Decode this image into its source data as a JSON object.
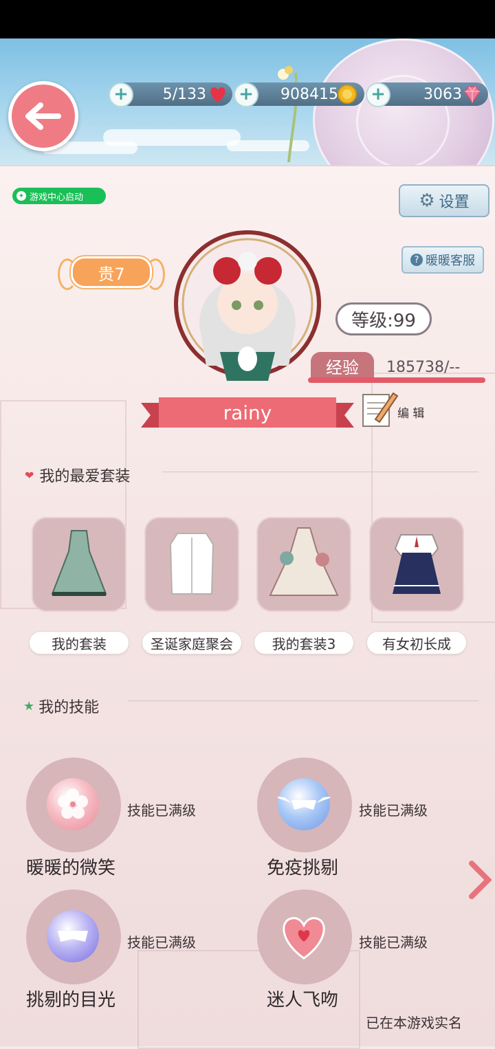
{
  "header": {
    "stamina": "5/133",
    "gold": "908415",
    "diamonds": "3063"
  },
  "badges": {
    "game_center": "游戏中心启动"
  },
  "buttons": {
    "settings": "设置",
    "customer_service": "暖暖客服",
    "edit": "编 辑"
  },
  "profile": {
    "vip": "贵7",
    "level": "等级:99",
    "exp_label": "经验",
    "exp_value": "185738/--",
    "name": "rainy"
  },
  "favorites": {
    "title": "我的最爱套装",
    "items": [
      {
        "label": "我的套装"
      },
      {
        "label": "圣诞家庭聚会"
      },
      {
        "label": "我的套装3"
      },
      {
        "label": "有女初长成"
      }
    ]
  },
  "skills": {
    "title": "我的技能",
    "items": [
      {
        "name": "暖暖的微笑",
        "status": "技能已满级",
        "icon": "sakura-icon"
      },
      {
        "name": "免疫挑剔",
        "status": "技能已满级",
        "icon": "winged-mask-icon"
      },
      {
        "name": "挑剔的目光",
        "status": "技能已满级",
        "icon": "mask-icon"
      },
      {
        "name": "迷人飞吻",
        "status": "技能已满级",
        "icon": "heart-icon"
      }
    ]
  },
  "footer": {
    "note": "已在本游戏实名"
  },
  "colors": {
    "accent_pink": "#ef7c84",
    "ribbon": "#e9626c",
    "vip_orange": "#f7a35a",
    "online_green": "#1bbf57"
  }
}
